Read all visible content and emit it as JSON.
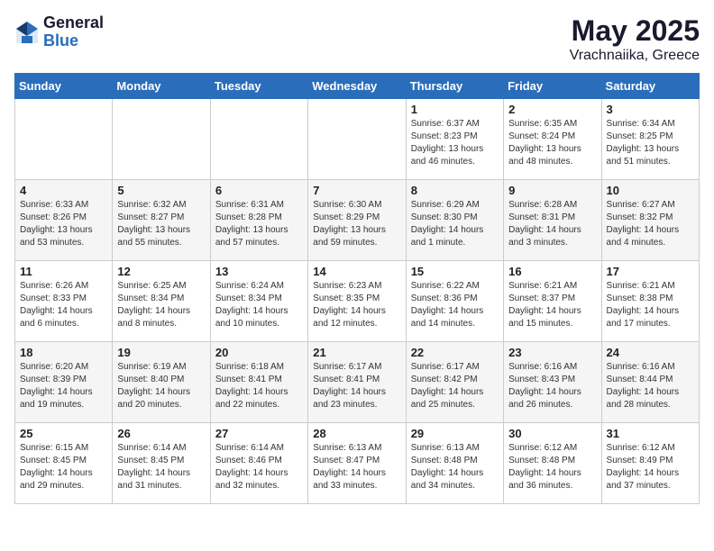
{
  "header": {
    "logo_general": "General",
    "logo_blue": "Blue",
    "title": "May 2025",
    "subtitle": "Vrachnaiika, Greece"
  },
  "days_of_week": [
    "Sunday",
    "Monday",
    "Tuesday",
    "Wednesday",
    "Thursday",
    "Friday",
    "Saturday"
  ],
  "weeks": [
    [
      {
        "day": "",
        "info": ""
      },
      {
        "day": "",
        "info": ""
      },
      {
        "day": "",
        "info": ""
      },
      {
        "day": "",
        "info": ""
      },
      {
        "day": "1",
        "info": "Sunrise: 6:37 AM\nSunset: 8:23 PM\nDaylight: 13 hours\nand 46 minutes."
      },
      {
        "day": "2",
        "info": "Sunrise: 6:35 AM\nSunset: 8:24 PM\nDaylight: 13 hours\nand 48 minutes."
      },
      {
        "day": "3",
        "info": "Sunrise: 6:34 AM\nSunset: 8:25 PM\nDaylight: 13 hours\nand 51 minutes."
      }
    ],
    [
      {
        "day": "4",
        "info": "Sunrise: 6:33 AM\nSunset: 8:26 PM\nDaylight: 13 hours\nand 53 minutes."
      },
      {
        "day": "5",
        "info": "Sunrise: 6:32 AM\nSunset: 8:27 PM\nDaylight: 13 hours\nand 55 minutes."
      },
      {
        "day": "6",
        "info": "Sunrise: 6:31 AM\nSunset: 8:28 PM\nDaylight: 13 hours\nand 57 minutes."
      },
      {
        "day": "7",
        "info": "Sunrise: 6:30 AM\nSunset: 8:29 PM\nDaylight: 13 hours\nand 59 minutes."
      },
      {
        "day": "8",
        "info": "Sunrise: 6:29 AM\nSunset: 8:30 PM\nDaylight: 14 hours\nand 1 minute."
      },
      {
        "day": "9",
        "info": "Sunrise: 6:28 AM\nSunset: 8:31 PM\nDaylight: 14 hours\nand 3 minutes."
      },
      {
        "day": "10",
        "info": "Sunrise: 6:27 AM\nSunset: 8:32 PM\nDaylight: 14 hours\nand 4 minutes."
      }
    ],
    [
      {
        "day": "11",
        "info": "Sunrise: 6:26 AM\nSunset: 8:33 PM\nDaylight: 14 hours\nand 6 minutes."
      },
      {
        "day": "12",
        "info": "Sunrise: 6:25 AM\nSunset: 8:34 PM\nDaylight: 14 hours\nand 8 minutes."
      },
      {
        "day": "13",
        "info": "Sunrise: 6:24 AM\nSunset: 8:34 PM\nDaylight: 14 hours\nand 10 minutes."
      },
      {
        "day": "14",
        "info": "Sunrise: 6:23 AM\nSunset: 8:35 PM\nDaylight: 14 hours\nand 12 minutes."
      },
      {
        "day": "15",
        "info": "Sunrise: 6:22 AM\nSunset: 8:36 PM\nDaylight: 14 hours\nand 14 minutes."
      },
      {
        "day": "16",
        "info": "Sunrise: 6:21 AM\nSunset: 8:37 PM\nDaylight: 14 hours\nand 15 minutes."
      },
      {
        "day": "17",
        "info": "Sunrise: 6:21 AM\nSunset: 8:38 PM\nDaylight: 14 hours\nand 17 minutes."
      }
    ],
    [
      {
        "day": "18",
        "info": "Sunrise: 6:20 AM\nSunset: 8:39 PM\nDaylight: 14 hours\nand 19 minutes."
      },
      {
        "day": "19",
        "info": "Sunrise: 6:19 AM\nSunset: 8:40 PM\nDaylight: 14 hours\nand 20 minutes."
      },
      {
        "day": "20",
        "info": "Sunrise: 6:18 AM\nSunset: 8:41 PM\nDaylight: 14 hours\nand 22 minutes."
      },
      {
        "day": "21",
        "info": "Sunrise: 6:17 AM\nSunset: 8:41 PM\nDaylight: 14 hours\nand 23 minutes."
      },
      {
        "day": "22",
        "info": "Sunrise: 6:17 AM\nSunset: 8:42 PM\nDaylight: 14 hours\nand 25 minutes."
      },
      {
        "day": "23",
        "info": "Sunrise: 6:16 AM\nSunset: 8:43 PM\nDaylight: 14 hours\nand 26 minutes."
      },
      {
        "day": "24",
        "info": "Sunrise: 6:16 AM\nSunset: 8:44 PM\nDaylight: 14 hours\nand 28 minutes."
      }
    ],
    [
      {
        "day": "25",
        "info": "Sunrise: 6:15 AM\nSunset: 8:45 PM\nDaylight: 14 hours\nand 29 minutes."
      },
      {
        "day": "26",
        "info": "Sunrise: 6:14 AM\nSunset: 8:45 PM\nDaylight: 14 hours\nand 31 minutes."
      },
      {
        "day": "27",
        "info": "Sunrise: 6:14 AM\nSunset: 8:46 PM\nDaylight: 14 hours\nand 32 minutes."
      },
      {
        "day": "28",
        "info": "Sunrise: 6:13 AM\nSunset: 8:47 PM\nDaylight: 14 hours\nand 33 minutes."
      },
      {
        "day": "29",
        "info": "Sunrise: 6:13 AM\nSunset: 8:48 PM\nDaylight: 14 hours\nand 34 minutes."
      },
      {
        "day": "30",
        "info": "Sunrise: 6:12 AM\nSunset: 8:48 PM\nDaylight: 14 hours\nand 36 minutes."
      },
      {
        "day": "31",
        "info": "Sunrise: 6:12 AM\nSunset: 8:49 PM\nDaylight: 14 hours\nand 37 minutes."
      }
    ]
  ]
}
